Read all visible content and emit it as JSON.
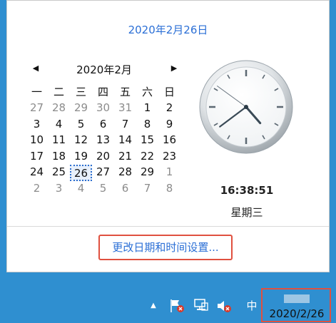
{
  "popup": {
    "full_date": "2020年2月26日",
    "calendar": {
      "month_title": "2020年2月",
      "prev_label": "◀",
      "next_label": "▶",
      "weekdays": [
        "一",
        "二",
        "三",
        "四",
        "五",
        "六",
        "日"
      ],
      "days": [
        {
          "d": "27",
          "muted": true
        },
        {
          "d": "28",
          "muted": true
        },
        {
          "d": "29",
          "muted": true
        },
        {
          "d": "30",
          "muted": true
        },
        {
          "d": "31",
          "muted": true
        },
        {
          "d": "1",
          "muted": false
        },
        {
          "d": "2",
          "muted": false
        },
        {
          "d": "3",
          "muted": false
        },
        {
          "d": "4",
          "muted": false
        },
        {
          "d": "5",
          "muted": false
        },
        {
          "d": "6",
          "muted": false
        },
        {
          "d": "7",
          "muted": false
        },
        {
          "d": "8",
          "muted": false
        },
        {
          "d": "9",
          "muted": false
        },
        {
          "d": "10",
          "muted": false
        },
        {
          "d": "11",
          "muted": false
        },
        {
          "d": "12",
          "muted": false
        },
        {
          "d": "13",
          "muted": false
        },
        {
          "d": "14",
          "muted": false
        },
        {
          "d": "15",
          "muted": false
        },
        {
          "d": "16",
          "muted": false
        },
        {
          "d": "17",
          "muted": false
        },
        {
          "d": "18",
          "muted": false
        },
        {
          "d": "19",
          "muted": false
        },
        {
          "d": "20",
          "muted": false
        },
        {
          "d": "21",
          "muted": false
        },
        {
          "d": "22",
          "muted": false
        },
        {
          "d": "23",
          "muted": false
        },
        {
          "d": "24",
          "muted": false
        },
        {
          "d": "25",
          "muted": false
        },
        {
          "d": "26",
          "muted": false,
          "today": true
        },
        {
          "d": "27",
          "muted": false
        },
        {
          "d": "28",
          "muted": false
        },
        {
          "d": "29",
          "muted": false
        },
        {
          "d": "1",
          "muted": true
        },
        {
          "d": "2",
          "muted": true
        },
        {
          "d": "3",
          "muted": true
        },
        {
          "d": "4",
          "muted": true
        },
        {
          "d": "5",
          "muted": true
        },
        {
          "d": "6",
          "muted": true
        },
        {
          "d": "7",
          "muted": true
        },
        {
          "d": "8",
          "muted": true
        }
      ]
    },
    "clock": {
      "time_text": "16:38:51",
      "weekday_text": "星期三",
      "hour": 16,
      "minute": 38,
      "second": 51
    },
    "settings_link": "更改日期和时间设置..."
  },
  "taskbar": {
    "tray_icons": [
      "show-hidden-icons-icon",
      "action-center-flag-icon",
      "network-icon",
      "volume-muted-icon"
    ],
    "ime_label": "中",
    "date_text": "2020/2/26"
  },
  "colors": {
    "accent": "#2b6fd6",
    "highlight_border": "#e0503f",
    "taskbar": "#2f8fd0"
  }
}
